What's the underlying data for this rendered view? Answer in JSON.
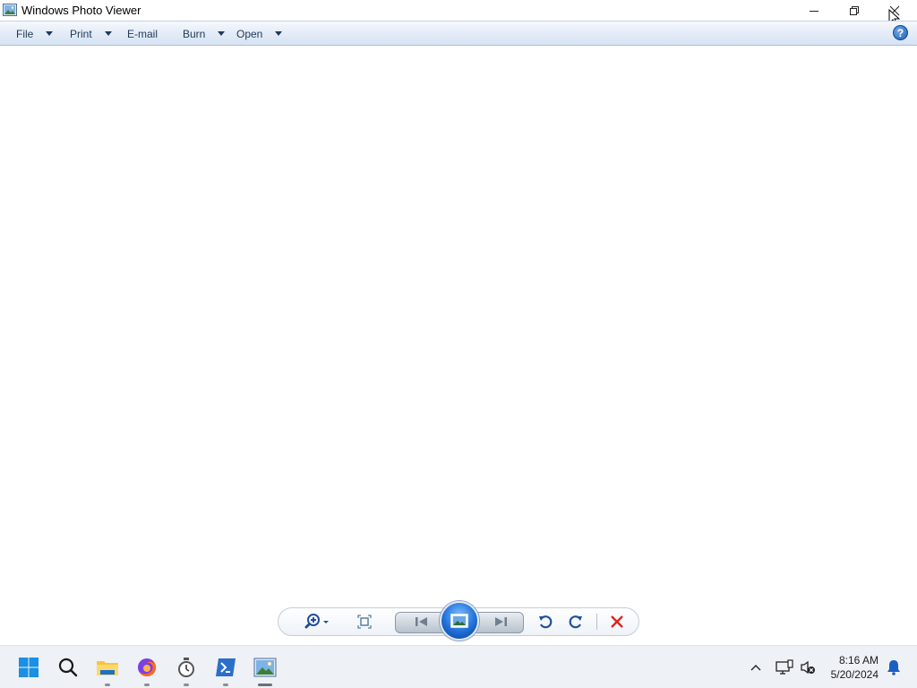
{
  "window": {
    "title": "Windows Photo Viewer"
  },
  "menu": {
    "items": [
      {
        "label": "File",
        "has_dropdown": true
      },
      {
        "label": "Print",
        "has_dropdown": true
      },
      {
        "label": "E-mail",
        "has_dropdown": false
      },
      {
        "label": "Burn",
        "has_dropdown": true
      },
      {
        "label": "Open",
        "has_dropdown": true
      }
    ],
    "help_label": "?"
  },
  "controls": {
    "icons": [
      "zoom-icon",
      "fit-to-window-icon",
      "previous-icon",
      "slideshow-icon",
      "next-icon",
      "rotate-counterclockwise-icon",
      "rotate-clockwise-icon",
      "delete-icon"
    ]
  },
  "taskbar": {
    "apps": [
      "start-icon",
      "search-icon",
      "file-explorer-icon",
      "firefox-icon",
      "clock-app-icon",
      "powershell-icon",
      "photo-viewer-icon"
    ],
    "time": "8:16 AM",
    "date": "5/20/2024"
  },
  "colors": {
    "menubar_text": "#1e395b",
    "accent_blue": "#1f6fd8",
    "delete_red": "#d8261f"
  }
}
